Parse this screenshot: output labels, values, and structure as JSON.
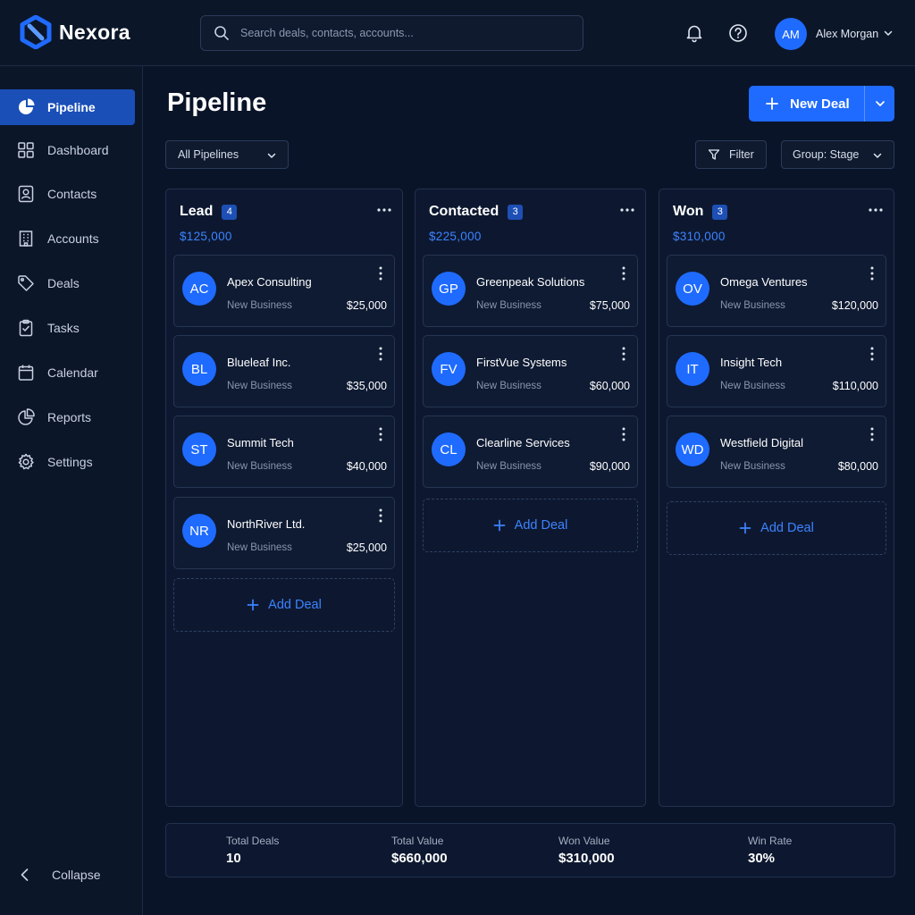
{
  "app": {
    "name": "Nexora"
  },
  "search": {
    "placeholder": "Search deals, contacts, accounts..."
  },
  "user": {
    "initials": "AM",
    "name": "Alex Morgan"
  },
  "sidebar": {
    "items": [
      {
        "label": "Pipeline",
        "icon": "pie-icon",
        "active": true
      },
      {
        "label": "Dashboard",
        "icon": "grid-icon"
      },
      {
        "label": "Contacts",
        "icon": "contact-icon"
      },
      {
        "label": "Accounts",
        "icon": "building-icon"
      },
      {
        "label": "Deals",
        "icon": "tag-icon"
      },
      {
        "label": "Tasks",
        "icon": "clipboard-icon"
      },
      {
        "label": "Calendar",
        "icon": "calendar-icon"
      },
      {
        "label": "Reports",
        "icon": "chart-icon"
      },
      {
        "label": "Settings",
        "icon": "gear-icon"
      }
    ],
    "collapse_label": "Collapse"
  },
  "page": {
    "title": "Pipeline",
    "new_deal_label": "New Deal",
    "pipeline_filter": "All Pipelines",
    "filter_label": "Filter",
    "group_label": "Group: Stage"
  },
  "columns": [
    {
      "title": "Lead",
      "count": "4",
      "total": "$125,000",
      "cards": [
        {
          "initials": "AC",
          "name": "Apex Consulting",
          "type": "New Business",
          "value": "$25,000"
        },
        {
          "initials": "BL",
          "name": "Blueleaf Inc.",
          "type": "New Business",
          "value": "$35,000"
        },
        {
          "initials": "ST",
          "name": "Summit Tech",
          "type": "New Business",
          "value": "$40,000"
        },
        {
          "initials": "NR",
          "name": "NorthRiver Ltd.",
          "type": "New Business",
          "value": "$25,000"
        }
      ],
      "add_label": "Add Deal"
    },
    {
      "title": "Contacted",
      "count": "3",
      "total": "$225,000",
      "cards": [
        {
          "initials": "GP",
          "name": "Greenpeak Solutions",
          "type": "New Business",
          "value": "$75,000"
        },
        {
          "initials": "FV",
          "name": "FirstVue Systems",
          "type": "New Business",
          "value": "$60,000"
        },
        {
          "initials": "CL",
          "name": "Clearline Services",
          "type": "New Business",
          "value": "$90,000"
        }
      ],
      "add_label": "Add Deal"
    },
    {
      "title": "Won",
      "count": "3",
      "total": "$310,000",
      "cards": [
        {
          "initials": "OV",
          "name": "Omega Ventures",
          "type": "New Business",
          "value": "$120,000"
        },
        {
          "initials": "IT",
          "name": "Insight Tech",
          "type": "New Business",
          "value": "$110,000"
        },
        {
          "initials": "WD",
          "name": "Westfield Digital",
          "type": "New Business",
          "value": "$80,000"
        }
      ],
      "add_label": "Add Deal"
    }
  ],
  "stats": [
    {
      "label": "Total Deals",
      "value": "10"
    },
    {
      "label": "Total Value",
      "value": "$660,000"
    },
    {
      "label": "Won Value",
      "value": "$310,000"
    },
    {
      "label": "Win Rate",
      "value": "30%"
    }
  ],
  "colors": {
    "accent": "#1f6bff",
    "background": "#0a1428",
    "panel": "#0d1830"
  }
}
